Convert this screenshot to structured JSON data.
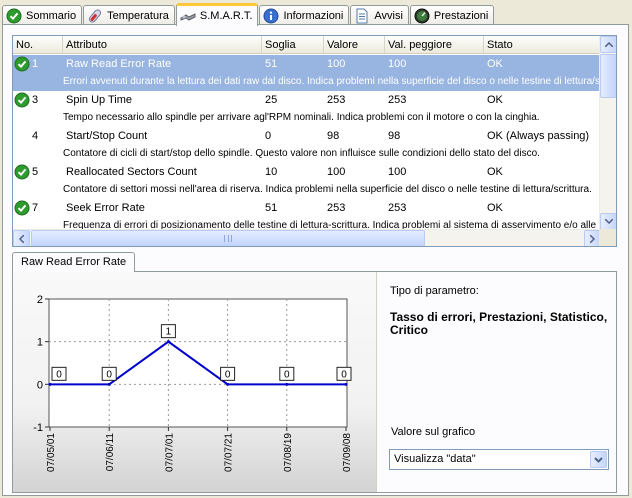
{
  "tabs": [
    {
      "label": "Sommario",
      "icon": "check-circle-icon",
      "active": false
    },
    {
      "label": "Temperatura",
      "icon": "thermometer-icon",
      "active": false
    },
    {
      "label": "S.M.A.R.T.",
      "icon": "smart-tools-icon",
      "active": true
    },
    {
      "label": "Informazioni",
      "icon": "info-icon",
      "active": false
    },
    {
      "label": "Avvisi",
      "icon": "document-icon",
      "active": false
    },
    {
      "label": "Prestazioni",
      "icon": "gauge-icon",
      "active": false
    }
  ],
  "columns": {
    "no": "No.",
    "attribute": "Attributo",
    "threshold": "Soglia",
    "value": "Valore",
    "worst": "Val. peggiore",
    "status": "Stato"
  },
  "rows": [
    {
      "no": "1",
      "name": "Raw Read Error Rate",
      "threshold": "51",
      "value": "100",
      "worst": "100",
      "status": "OK",
      "ok_icon": true,
      "selected": true,
      "desc": "Errori avvenuti durante la lettura dei dati raw dal disco. Indica problemi nella superficie del disco o nelle testine di lettura/scrittura."
    },
    {
      "no": "3",
      "name": "Spin Up Time",
      "threshold": "25",
      "value": "253",
      "worst": "253",
      "status": "OK",
      "ok_icon": true,
      "selected": false,
      "desc": "Tempo necessario allo spindle per arrivare agl'RPM nominali. Indica problemi con il motore o con la cinghia."
    },
    {
      "no": "4",
      "name": "Start/Stop Count",
      "threshold": "0",
      "value": "98",
      "worst": "98",
      "status": "OK (Always passing)",
      "ok_icon": false,
      "selected": false,
      "desc": "Contatore di cicli di start/stop dello spindle. Questo valore non influisce sulle condizioni dello stato del disco."
    },
    {
      "no": "5",
      "name": "Reallocated Sectors Count",
      "threshold": "10",
      "value": "100",
      "worst": "100",
      "status": "OK",
      "ok_icon": true,
      "selected": false,
      "desc": "Contatore di settori mossi nell'area di riserva. Indica problemi nella superficie del disco o nelle testine di lettura/scrittura."
    },
    {
      "no": "7",
      "name": "Seek Error Rate",
      "threshold": "51",
      "value": "253",
      "worst": "253",
      "status": "OK",
      "ok_icon": true,
      "selected": false,
      "desc": "Frequenza di errori di posizionamento delle testine di lettura-scrittura. Indica problemi al sistema di asservimento e/o alle testine. L'a"
    }
  ],
  "subtab": {
    "label": "Raw Read Error Rate"
  },
  "info": {
    "param_type_label": "Tipo di parametro:",
    "param_type_value": "Tasso di errori, Prestazioni, Statistico, Critico",
    "graph_value_label": "Valore sul grafico",
    "graph_value_selected": "Visualizza \"data\""
  },
  "chart_data": {
    "type": "line",
    "x": [
      "07/05/01",
      "07/06/11",
      "07/07/01",
      "07/07/21",
      "07/08/19",
      "07/09/08"
    ],
    "series": [
      {
        "values": [
          0,
          0,
          1,
          0,
          0,
          0
        ]
      }
    ],
    "data_labels": [
      "0",
      "0",
      "1",
      "0",
      "0",
      "0"
    ],
    "yticks": [
      "2",
      "1",
      "0",
      "-1"
    ],
    "ylim": [
      -1,
      2
    ],
    "grid": true,
    "line_color": "#0000cc"
  }
}
